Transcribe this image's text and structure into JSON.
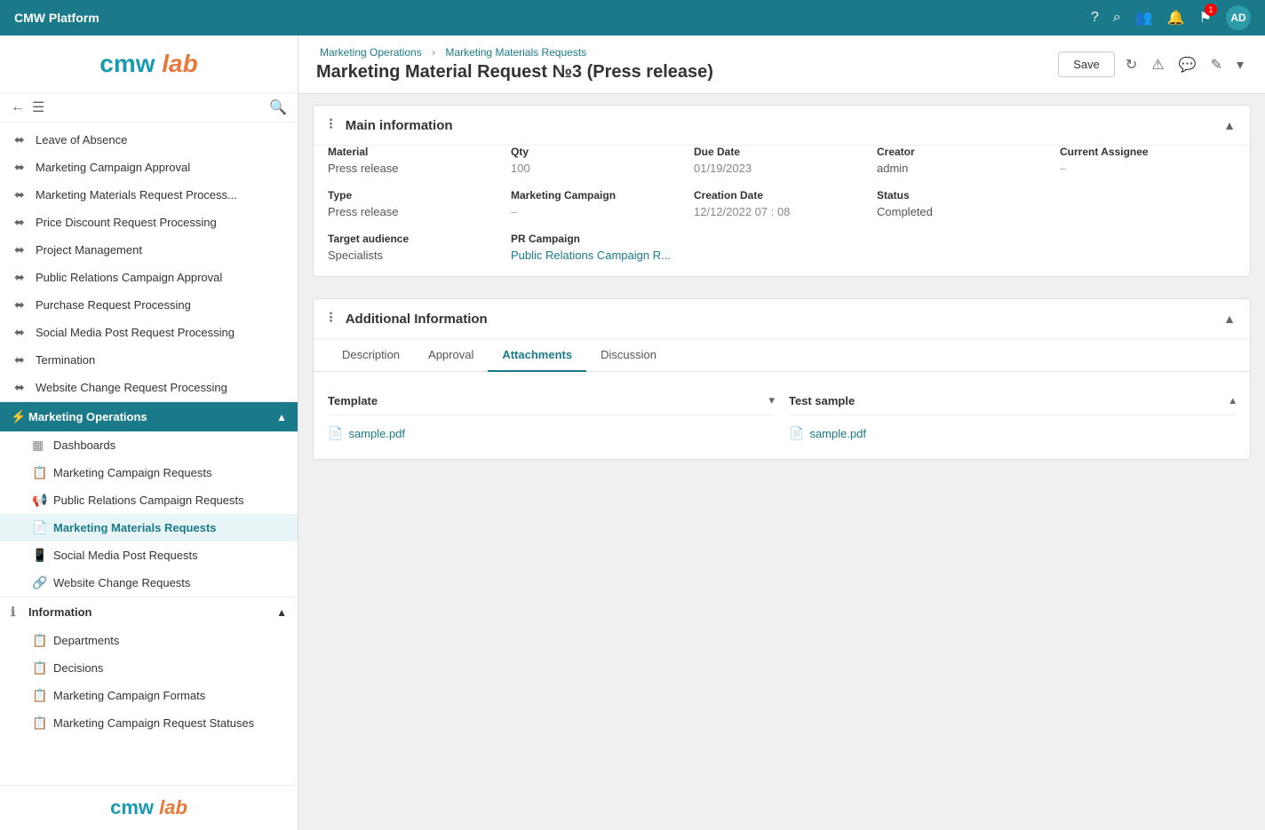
{
  "topnav": {
    "title": "CMW Platform",
    "avatar_initials": "AD"
  },
  "breadcrumb": {
    "items": [
      "Marketing Operations",
      "Marketing Materials Requests"
    ],
    "separator": "›"
  },
  "page": {
    "title": "Marketing Material Request №3 (Press release)"
  },
  "header_actions": {
    "save_label": "Save"
  },
  "sidebar": {
    "logo_cmw": "cmw",
    "logo_lab": "lab",
    "nav_items": [
      {
        "id": "leave-of-absence",
        "label": "Leave of Absence",
        "type": "workflow"
      },
      {
        "id": "marketing-campaign-approval",
        "label": "Marketing Campaign Approval",
        "type": "workflow"
      },
      {
        "id": "marketing-materials-request-process",
        "label": "Marketing Materials Request Process...",
        "type": "workflow"
      },
      {
        "id": "price-discount-request-processing",
        "label": "Price Discount Request Processing",
        "type": "workflow"
      },
      {
        "id": "project-management",
        "label": "Project Management",
        "type": "workflow"
      },
      {
        "id": "public-relations-campaign-approval",
        "label": "Public Relations Campaign Approval",
        "type": "workflow"
      },
      {
        "id": "purchase-request-processing",
        "label": "Purchase Request Processing",
        "type": "workflow"
      },
      {
        "id": "social-media-post-request-processing",
        "label": "Social Media Post Request Processing",
        "type": "workflow"
      },
      {
        "id": "termination",
        "label": "Termination",
        "type": "workflow"
      },
      {
        "id": "website-change-request-processing",
        "label": "Website Change Request Processing",
        "type": "workflow"
      }
    ],
    "marketing_ops": {
      "label": "Marketing Operations",
      "is_active": true,
      "sub_items": [
        {
          "id": "dashboards",
          "label": "Dashboards",
          "icon": "dashboard"
        },
        {
          "id": "marketing-campaign-requests",
          "label": "Marketing Campaign Requests",
          "icon": "campaign"
        },
        {
          "id": "public-relations-campaign-requests",
          "label": "Public Relations Campaign Requests",
          "icon": "pr"
        },
        {
          "id": "marketing-materials-requests",
          "label": "Marketing Materials Requests",
          "icon": "materials",
          "selected": true
        },
        {
          "id": "social-media-post-requests",
          "label": "Social Media Post Requests",
          "icon": "social"
        },
        {
          "id": "website-change-requests",
          "label": "Website Change Requests",
          "icon": "website"
        }
      ]
    },
    "information": {
      "label": "Information",
      "sub_items": [
        {
          "id": "departments",
          "label": "Departments"
        },
        {
          "id": "decisions",
          "label": "Decisions"
        },
        {
          "id": "marketing-campaign-formats",
          "label": "Marketing Campaign Formats"
        },
        {
          "id": "marketing-campaign-request-statuses",
          "label": "Marketing Campaign Request Statuses"
        }
      ]
    },
    "footer_logo_cmw": "cmw",
    "footer_logo_lab": "lab"
  },
  "main_info": {
    "section_title": "Main information",
    "fields": {
      "material_label": "Material",
      "material_value": "Press release",
      "qty_label": "Qty",
      "qty_value": "100",
      "due_date_label": "Due Date",
      "due_date_value": "01/19/2023",
      "creator_label": "Creator",
      "creator_value": "admin",
      "current_assignee_label": "Current Assignee",
      "current_assignee_value": "–",
      "type_label": "Type",
      "type_value": "Press release",
      "marketing_campaign_label": "Marketing Campaign",
      "marketing_campaign_value": "–",
      "creation_date_label": "Creation Date",
      "creation_date_value": "12/12/2022   07 : 08",
      "status_label": "Status",
      "status_value": "Completed",
      "target_audience_label": "Target audience",
      "target_audience_value": "Specialists",
      "pr_campaign_label": "PR Campaign",
      "pr_campaign_value": "Public Relations Campaign R..."
    }
  },
  "additional_info": {
    "section_title": "Additional Information",
    "tabs": [
      {
        "id": "description",
        "label": "Description"
      },
      {
        "id": "approval",
        "label": "Approval"
      },
      {
        "id": "attachments",
        "label": "Attachments",
        "active": true
      },
      {
        "id": "discussion",
        "label": "Discussion"
      }
    ],
    "attachments": {
      "template": {
        "title": "Template",
        "file": "sample.pdf",
        "collapsed": true
      },
      "test_sample": {
        "title": "Test sample",
        "file": "sample.pdf",
        "collapsed": false
      }
    }
  }
}
